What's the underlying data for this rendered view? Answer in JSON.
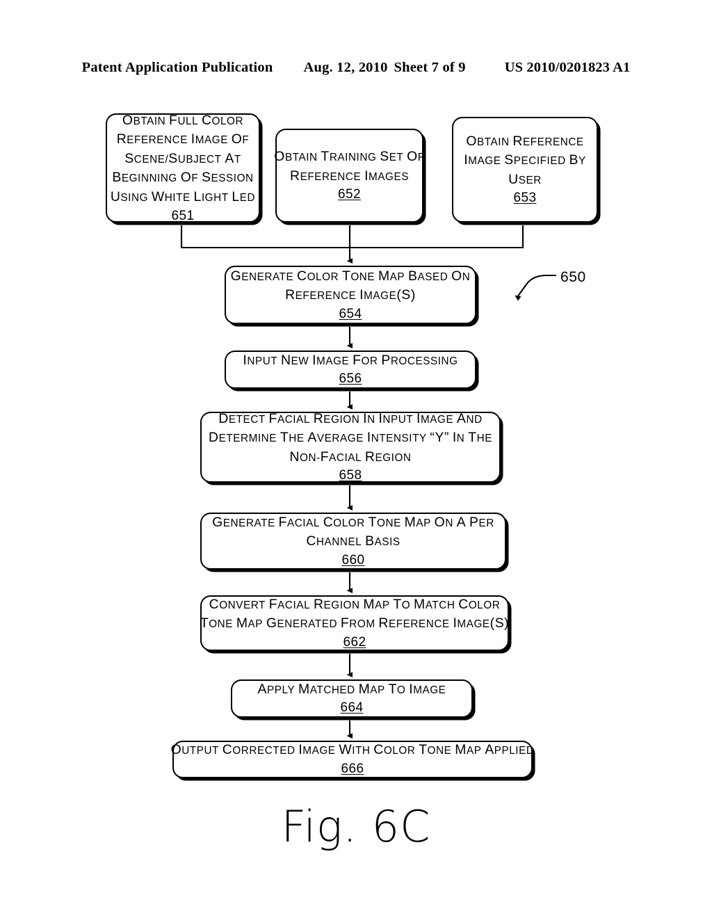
{
  "header": {
    "publication": "Patent Application Publication",
    "date": "Aug. 12, 2010",
    "sheet": "Sheet 7 of 9",
    "document_number": "US 2010/0201823 A1"
  },
  "figure": {
    "caption": "Fig. 6C",
    "reference_numeral": "650"
  },
  "flowchart": {
    "boxes": [
      {
        "id": "651",
        "lines": [
          "Obtain full color",
          "reference image of",
          "scene/subject at",
          "beginning of session",
          "using white light LED"
        ],
        "step": "651"
      },
      {
        "id": "652",
        "lines": [
          "Obtain training set of",
          "reference images"
        ],
        "step": "652"
      },
      {
        "id": "653",
        "lines": [
          "Obtain reference",
          "image specified by",
          "user"
        ],
        "step": "653"
      },
      {
        "id": "654",
        "lines": [
          "Generate color tone map based on",
          "reference image(s)"
        ],
        "step": "654"
      },
      {
        "id": "656",
        "lines": [
          "Input new image for processing"
        ],
        "step": "656"
      },
      {
        "id": "658",
        "lines": [
          "Detect facial region in input image and",
          "determine the average intensity “Y” in the",
          "non-facial region"
        ],
        "step": "658"
      },
      {
        "id": "660",
        "lines": [
          "Generate facial color tone map on a per",
          "channel basis"
        ],
        "step": "660"
      },
      {
        "id": "662",
        "lines": [
          "Convert facial region map to match color",
          "tone map generated from reference image(s)"
        ],
        "step": "662"
      },
      {
        "id": "664",
        "lines": [
          "Apply matched map to image"
        ],
        "step": "664"
      },
      {
        "id": "666",
        "lines": [
          "Output corrected image with color tone map applied"
        ],
        "step": "666"
      }
    ]
  },
  "colors": {
    "ink": "#000000",
    "page": "#ffffff"
  }
}
